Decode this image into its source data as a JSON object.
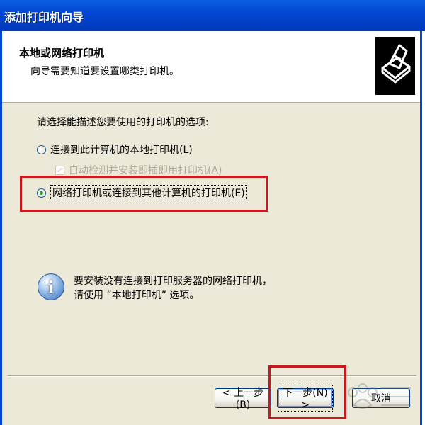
{
  "window": {
    "title": "添加打印机向导"
  },
  "header": {
    "title": "本地或网络打印机",
    "subtitle": "向导需要知道要设置哪类打印机。",
    "icon": "printer-icon"
  },
  "prompt": "请选择能描述您要使用的打印机的选项:",
  "options": [
    {
      "label": "连接到此计算机的本地打印机(L)",
      "selected": false
    },
    {
      "label": "网络打印机或连接到其他计算机的打印机(E)",
      "selected": true
    }
  ],
  "autodetect": {
    "label": "自动检测并安装即插即用打印机(A)",
    "checked": true,
    "enabled": false
  },
  "info": {
    "icon": "info-icon",
    "line1": "要安装没有连接到打印服务器的网络打印机，",
    "line2": "请使用 “本地打印机” 选项。"
  },
  "buttons": {
    "back": "< 上一步(B)",
    "next": "下一步(N) >",
    "cancel": "取消"
  },
  "highlight_color": "#c8191f",
  "title_bar_color": "#0347d4"
}
